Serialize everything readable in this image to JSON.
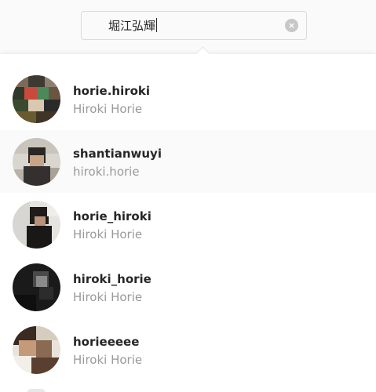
{
  "search": {
    "value": "堀江弘輝",
    "clear_icon": "clear-circle-icon"
  },
  "results": [
    {
      "username": "horie.hiroki",
      "fullname": "Hiroki Horie",
      "selected": false
    },
    {
      "username": "shantianwuyi",
      "fullname": "hiroki.horie",
      "selected": true
    },
    {
      "username": "horie_hiroki",
      "fullname": "Hiroki Horie",
      "selected": false
    },
    {
      "username": "hiroki_horie",
      "fullname": "Hiroki Horie",
      "selected": false
    },
    {
      "username": "horieeeee",
      "fullname": "Hiroki Horie",
      "selected": false
    }
  ],
  "colors": {
    "username": "#262626",
    "fullname": "#999999",
    "selected_row": "#fafafa"
  }
}
